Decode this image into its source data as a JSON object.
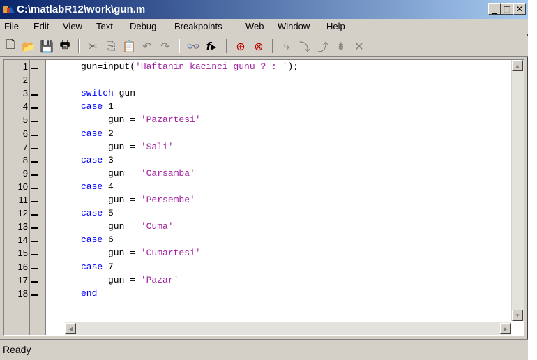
{
  "window": {
    "title": "C:\\matlabR12\\work\\gun.m"
  },
  "title_buttons": {
    "minimize": "_",
    "maximize": "□",
    "close": "✕"
  },
  "menu": [
    "File",
    "Edit",
    "View",
    "Text",
    "Debug",
    "Breakpoints",
    "Web",
    "Window",
    "Help"
  ],
  "toolbar": {
    "icons": [
      "new-file-icon",
      "open-folder-icon",
      "save-icon",
      "print-icon",
      "cut-icon",
      "copy-icon",
      "paste-icon",
      "undo-icon",
      "redo-icon",
      "find-icon",
      "function-icon",
      "set-breakpoint-icon",
      "clear-breakpoint-icon",
      "step-icon",
      "step-in-icon",
      "step-out-icon",
      "continue-icon",
      "exit-debug-icon"
    ],
    "glyphs": {
      "new": "🗋",
      "open": "📂",
      "save": "💾",
      "print": "🖶",
      "cut": "✂",
      "copy": "⎘",
      "paste": "📋",
      "undo": "↶",
      "redo": "↷",
      "find": "👓",
      "func": "f▸",
      "setbp": "⊕",
      "clearbp": "⊗",
      "step": "⤷",
      "stepin": "⤵",
      "stepout": "⤴",
      "continue": "⇟",
      "exit": "✕"
    }
  },
  "editor": {
    "line_numbers": [
      "1",
      "2",
      "3",
      "4",
      "5",
      "6",
      "7",
      "8",
      "9",
      "10",
      "11",
      "12",
      "13",
      "14",
      "15",
      "16",
      "17",
      "18"
    ],
    "lines": [
      {
        "parts": [
          {
            "t": "gun=input(",
            "c": ""
          },
          {
            "t": "'Haftanin kacinci gunu ? : '",
            "c": "str"
          },
          {
            "t": ");",
            "c": ""
          }
        ]
      },
      {
        "parts": []
      },
      {
        "parts": [
          {
            "t": "switch",
            "c": "kw"
          },
          {
            "t": " gun",
            "c": ""
          }
        ]
      },
      {
        "parts": [
          {
            "t": "case",
            "c": "kw"
          },
          {
            "t": " 1",
            "c": ""
          }
        ]
      },
      {
        "parts": [
          {
            "t": "     gun = ",
            "c": ""
          },
          {
            "t": "'Pazartesi'",
            "c": "str"
          }
        ]
      },
      {
        "parts": [
          {
            "t": "case",
            "c": "kw"
          },
          {
            "t": " 2",
            "c": ""
          }
        ]
      },
      {
        "parts": [
          {
            "t": "     gun = ",
            "c": ""
          },
          {
            "t": "'Sali'",
            "c": "str"
          }
        ]
      },
      {
        "parts": [
          {
            "t": "case",
            "c": "kw"
          },
          {
            "t": " 3",
            "c": ""
          }
        ]
      },
      {
        "parts": [
          {
            "t": "     gun = ",
            "c": ""
          },
          {
            "t": "'Carsamba'",
            "c": "str"
          }
        ]
      },
      {
        "parts": [
          {
            "t": "case",
            "c": "kw"
          },
          {
            "t": " 4",
            "c": ""
          }
        ]
      },
      {
        "parts": [
          {
            "t": "     gun = ",
            "c": ""
          },
          {
            "t": "'Persembe'",
            "c": "str"
          }
        ]
      },
      {
        "parts": [
          {
            "t": "case",
            "c": "kw"
          },
          {
            "t": " 5",
            "c": ""
          }
        ]
      },
      {
        "parts": [
          {
            "t": "     gun = ",
            "c": ""
          },
          {
            "t": "'Cuma'",
            "c": "str"
          }
        ]
      },
      {
        "parts": [
          {
            "t": "case",
            "c": "kw"
          },
          {
            "t": " 6",
            "c": ""
          }
        ]
      },
      {
        "parts": [
          {
            "t": "     gun = ",
            "c": ""
          },
          {
            "t": "'Cumartesi'",
            "c": "str"
          }
        ]
      },
      {
        "parts": [
          {
            "t": "case",
            "c": "kw"
          },
          {
            "t": " 7",
            "c": ""
          }
        ]
      },
      {
        "parts": [
          {
            "t": "     gun = ",
            "c": ""
          },
          {
            "t": "'Pazar'",
            "c": "str"
          }
        ]
      },
      {
        "parts": [
          {
            "t": "end",
            "c": "kw"
          }
        ]
      }
    ],
    "executable_marker_lines": [
      1,
      3,
      4,
      5,
      6,
      7,
      8,
      9,
      10,
      11,
      12,
      13,
      14,
      15,
      16,
      17,
      18
    ]
  },
  "status": {
    "text": "Ready"
  },
  "colors": {
    "keyword": "#0000ff",
    "string": "#a020a0",
    "titlebar_start": "#0a246a",
    "titlebar_end": "#a6caf0"
  }
}
